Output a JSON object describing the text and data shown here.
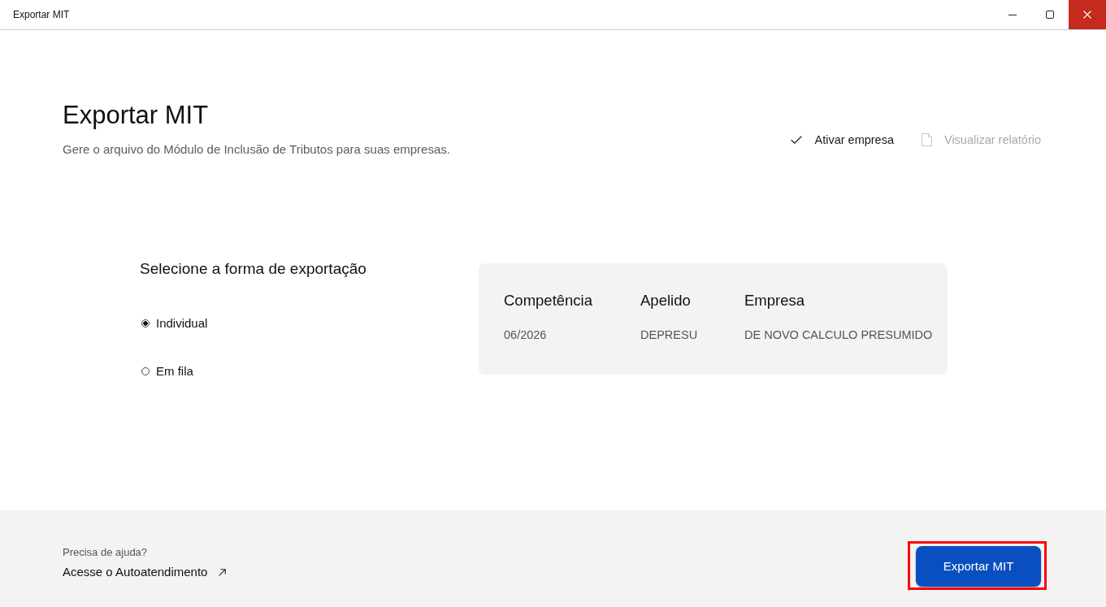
{
  "window": {
    "title": "Exportar MIT"
  },
  "header": {
    "title": "Exportar MIT",
    "subtitle": "Gere o arquivo do Módulo de Inclusão de Tributos para suas empresas.",
    "actions": [
      {
        "label": "Ativar empresa",
        "kind": "check",
        "disabled": false
      },
      {
        "label": "Visualizar relatório",
        "kind": "document",
        "disabled": true
      }
    ]
  },
  "export_mode": {
    "heading": "Selecione a forma de exportação",
    "options": [
      {
        "label": "Individual",
        "selected": true
      },
      {
        "label": "Em fila",
        "selected": false
      }
    ]
  },
  "summary": {
    "columns": [
      "Competência",
      "Apelido",
      "Empresa"
    ],
    "rows": [
      [
        "06/2026",
        "DEPRESU",
        "DE NOVO CALCULO PRESUMIDO"
      ]
    ]
  },
  "footer": {
    "help_label": "Precisa de ajuda?",
    "help_link": "Acesse o Autoatendimento",
    "primary_button": {
      "label": "Exportar MIT",
      "highlighted": true
    }
  }
}
